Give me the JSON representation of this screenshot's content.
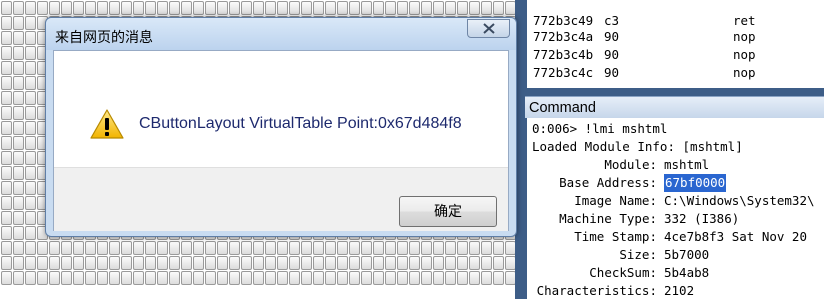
{
  "dialog": {
    "title": "来自网页的消息",
    "message": "CButtonLayout VirtualTable Point:0x67d484f8",
    "ok_label": "确定"
  },
  "disassembly": [
    {
      "addr": "772b3c49",
      "bytes": "c3",
      "mnemonic": "ret"
    },
    {
      "addr": "772b3c4a",
      "bytes": "90",
      "mnemonic": "nop"
    },
    {
      "addr": "772b3c4b",
      "bytes": "90",
      "mnemonic": "nop"
    },
    {
      "addr": "772b3c4c",
      "bytes": "90",
      "mnemonic": "nop"
    }
  ],
  "command": {
    "header": "Command",
    "prompt_line": "0:006> !lmi mshtml",
    "info_line": "Loaded Module Info: [mshtml]",
    "fields": [
      {
        "key": "Module:",
        "value": "mshtml",
        "highlight": false
      },
      {
        "key": "Base Address:",
        "value": "67bf0000",
        "highlight": true
      },
      {
        "key": "Image Name:",
        "value": "C:\\Windows\\System32\\",
        "highlight": false
      },
      {
        "key": "Machine Type:",
        "value": "332 (I386)",
        "highlight": false
      },
      {
        "key": "Time Stamp:",
        "value": "4ce7b8f3 Sat Nov 20",
        "highlight": false
      },
      {
        "key": "Size:",
        "value": "5b7000",
        "highlight": false
      },
      {
        "key": "CheckSum:",
        "value": "5b4ab8",
        "highlight": false
      },
      {
        "key": "Characteristics:",
        "value": "2102",
        "highlight": false
      }
    ]
  }
}
